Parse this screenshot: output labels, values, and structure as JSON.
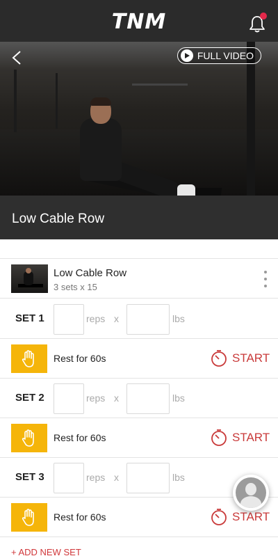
{
  "app": {
    "logo": "TNM"
  },
  "video": {
    "full_video_label": "FULL VIDEO"
  },
  "exercise_title": "Low Cable Row",
  "exercise": {
    "name": "Low Cable Row",
    "sets_summary": "3 sets x 15"
  },
  "sets": [
    {
      "label": "SET 1",
      "reps_unit": "reps",
      "times": "x",
      "weight_unit": "lbs",
      "rest_label": "Rest for 60s",
      "start_label": "START"
    },
    {
      "label": "SET 2",
      "reps_unit": "reps",
      "times": "x",
      "weight_unit": "lbs",
      "rest_label": "Rest for 60s",
      "start_label": "START"
    },
    {
      "label": "SET 3",
      "reps_unit": "reps",
      "times": "x",
      "weight_unit": "lbs",
      "rest_label": "Rest for 60s",
      "start_label": "START"
    }
  ],
  "add_set_label": "+ ADD NEW SET",
  "colors": {
    "accent_red": "#d0373a",
    "rest_yellow": "#f5b50a",
    "header_dark": "#2b2b2b",
    "notification_dot": "#e4284a"
  },
  "icons": [
    "bell-icon",
    "back-arrow-icon",
    "play-icon",
    "more-vertical-icon",
    "hand-icon",
    "timer-icon",
    "avatar-icon"
  ]
}
